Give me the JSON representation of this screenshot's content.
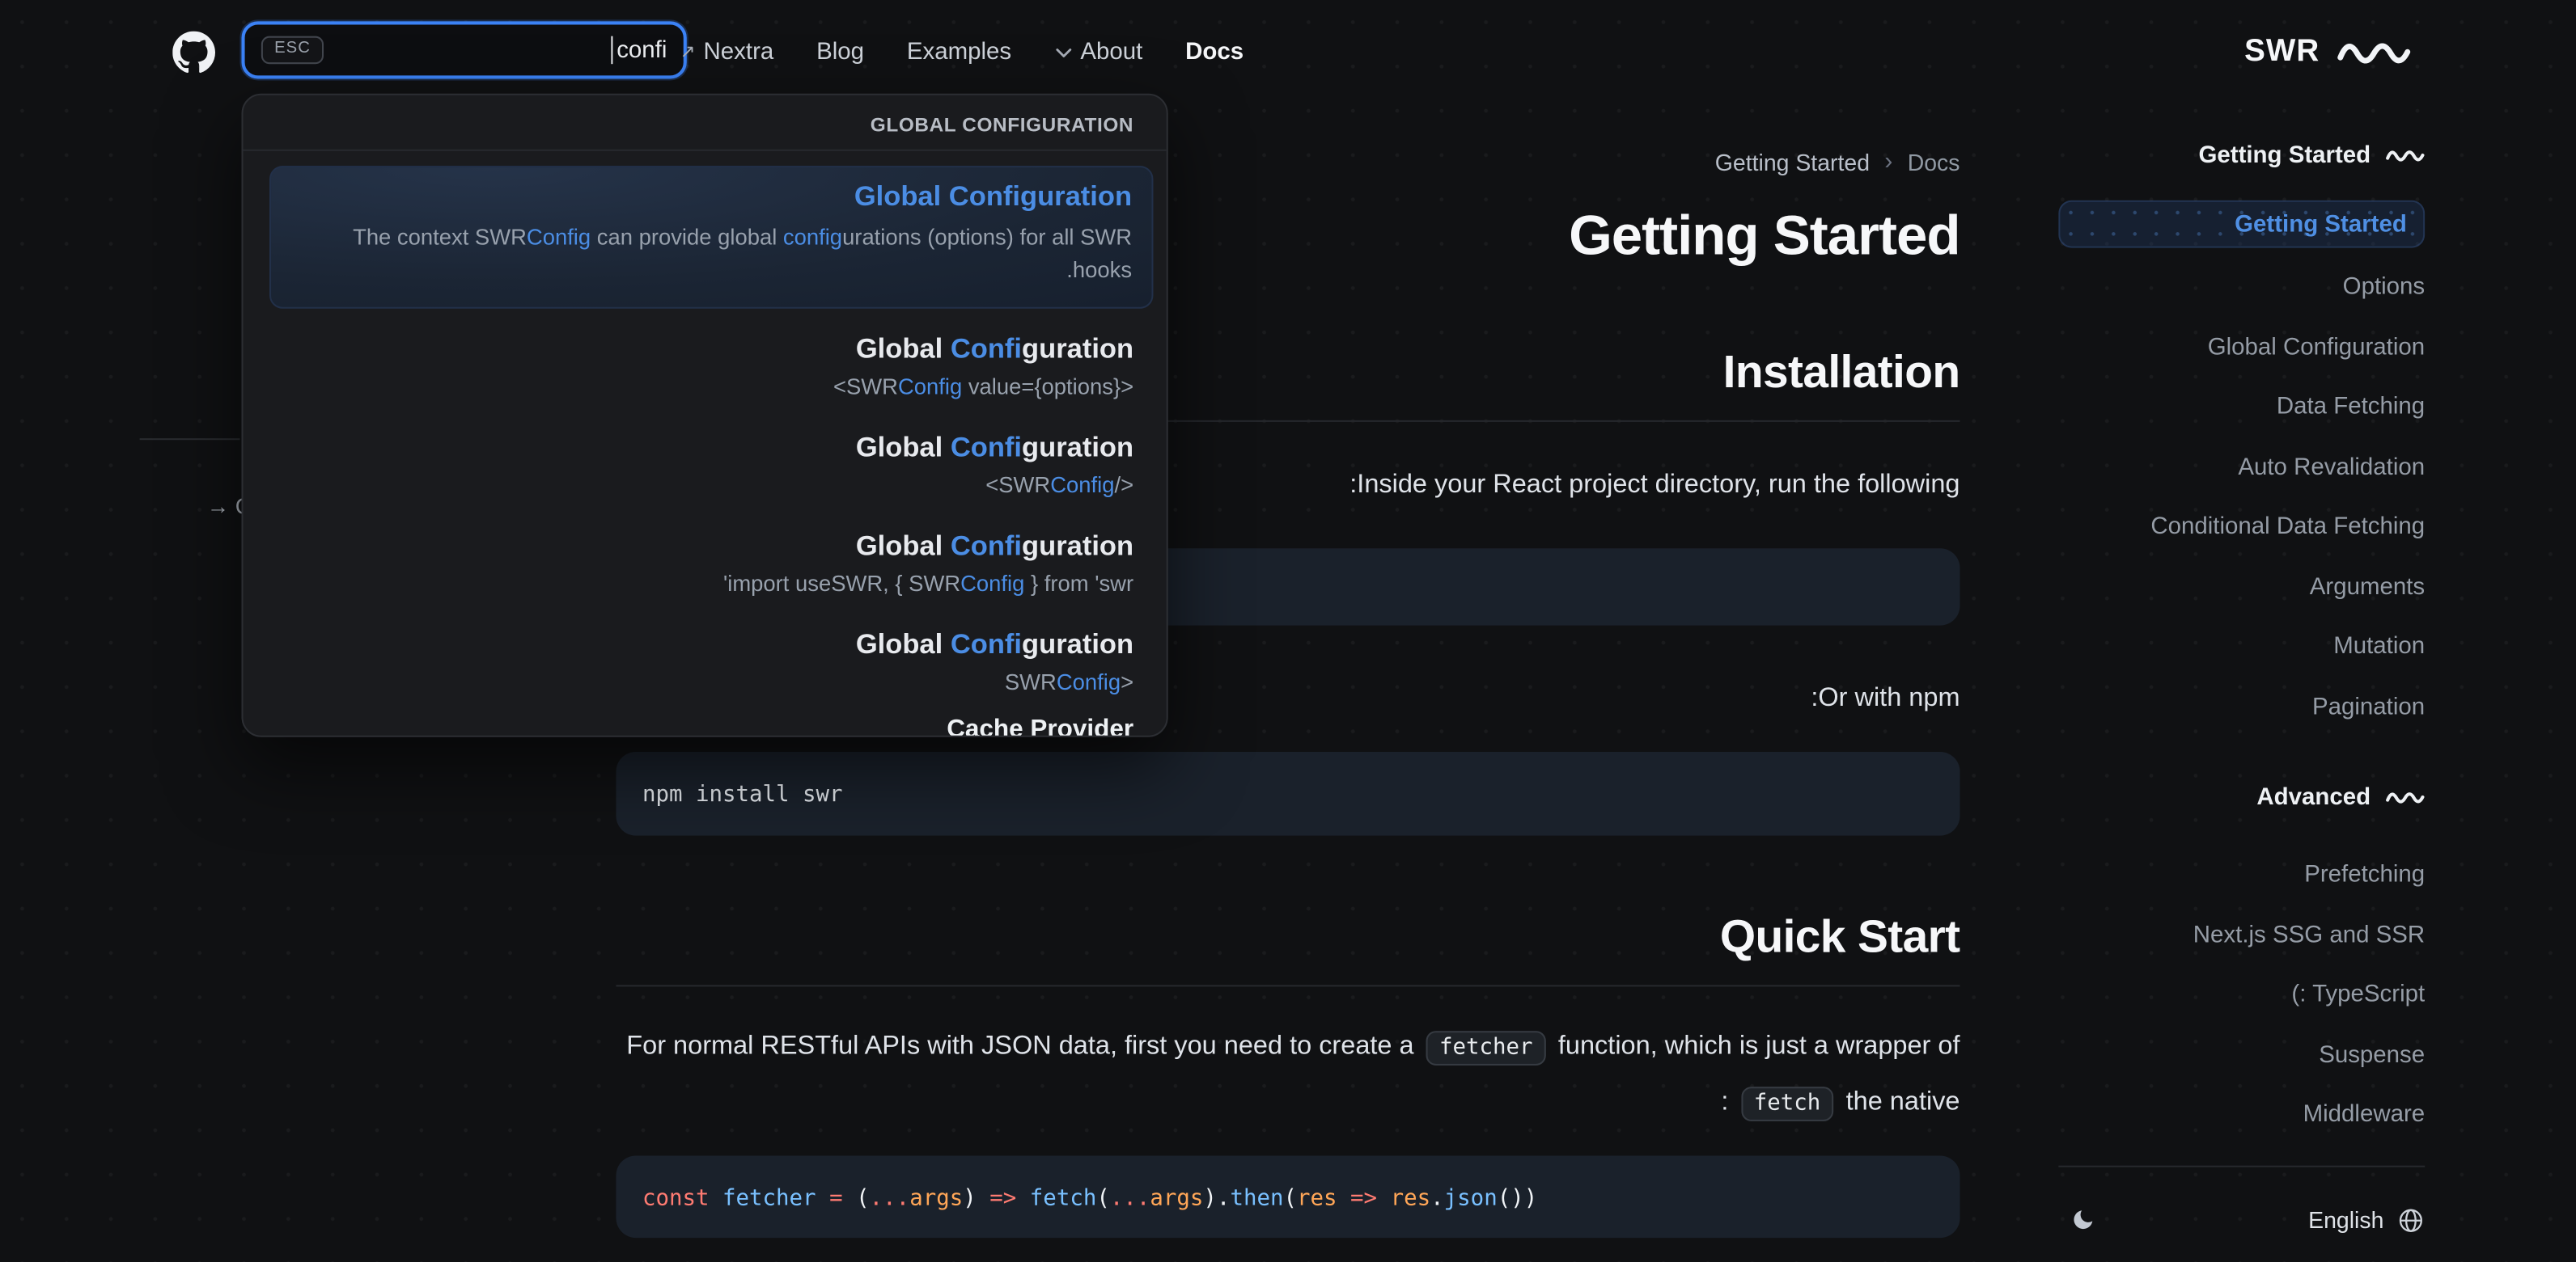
{
  "theme": {
    "accent": "#3b82f6",
    "match_highlight": "#4b8de4",
    "background": "#101113",
    "panel_background": "#1a1b1e",
    "code_background": "#1a212b"
  },
  "navbar": {
    "search": {
      "value": "confi",
      "esc": "ESC"
    },
    "links": {
      "nextra": "Nextra",
      "blog": "Blog",
      "examples": "Examples",
      "about": "About",
      "docs": "Docs"
    },
    "logo": "SWR"
  },
  "toc": {
    "fragment": "→ Q"
  },
  "search_overlay": {
    "section_header": "GLOBAL CONFIGURATION",
    "selected": {
      "title": "Global Configuration",
      "desc1_a": "The context SWR",
      "desc1_b": "Config",
      "desc1_c": " can provide global ",
      "desc1_d": "config",
      "desc1_e": "urations (options) for all SWR",
      "desc2": ".hooks"
    },
    "results": [
      {
        "pre": "Global ",
        "match": "Confi",
        "post": "guration",
        "sub_pre": "<SWR",
        "sub_match": "Config",
        "sub_post": " value={options}>"
      },
      {
        "pre": "Global ",
        "match": "Confi",
        "post": "guration",
        "sub_pre": "<SWR",
        "sub_match": "Config",
        "sub_post": "/>"
      },
      {
        "pre": "Global ",
        "match": "Confi",
        "post": "guration",
        "sub_pre": "'import useSWR, { SWR",
        "sub_match": "Config",
        "sub_post": " } from 'swr"
      },
      {
        "pre": "Global ",
        "match": "Confi",
        "post": "guration",
        "sub_pre": "SWR",
        "sub_match": "Config",
        "sub_post": ">"
      }
    ],
    "next_section": "Cache Provider"
  },
  "main": {
    "breadcrumb": {
      "page": "Getting Started",
      "sep": "›",
      "root": "Docs"
    },
    "title": "Getting Started",
    "installation": {
      "heading": "Installation",
      "intro": ":Inside your React project directory, run the following",
      "or_npm": ":Or with npm",
      "npm_code": "npm install swr"
    },
    "quickstart": {
      "heading": "Quick Start",
      "line1_a": "For normal RESTful APIs with JSON data, first you need to create a ",
      "code1": "fetcher",
      "line1_b": " function, which is just a wrapper of",
      "line2_a": ": ",
      "code2": "fetch",
      "line2_b": " the native",
      "tokens": [
        {
          "t": "const ",
          "c": "k"
        },
        {
          "t": "fetcher",
          "c": "v"
        },
        {
          "t": " ",
          "c": "p"
        },
        {
          "t": "=",
          "c": "k"
        },
        {
          "t": " (",
          "c": "p"
        },
        {
          "t": "...",
          "c": "k"
        },
        {
          "t": "args",
          "c": "a"
        },
        {
          "t": ") ",
          "c": "p"
        },
        {
          "t": "=>",
          "c": "k"
        },
        {
          "t": " ",
          "c": "p"
        },
        {
          "t": "fetch",
          "c": "v"
        },
        {
          "t": "(",
          "c": "p"
        },
        {
          "t": "...",
          "c": "k"
        },
        {
          "t": "args",
          "c": "a"
        },
        {
          "t": ").",
          "c": "p"
        },
        {
          "t": "then",
          "c": "v"
        },
        {
          "t": "(",
          "c": "p"
        },
        {
          "t": "res",
          "c": "a"
        },
        {
          "t": " ",
          "c": "p"
        },
        {
          "t": "=>",
          "c": "k"
        },
        {
          "t": " ",
          "c": "p"
        },
        {
          "t": "res",
          "c": "a"
        },
        {
          "t": ".",
          "c": "p"
        },
        {
          "t": "json",
          "c": "v"
        },
        {
          "t": "())",
          "c": "p"
        }
      ]
    }
  },
  "sidebar": {
    "sections": [
      {
        "title": "Getting Started",
        "items": [
          {
            "label": "Getting Started",
            "active": true
          },
          {
            "label": "Options"
          },
          {
            "label": "Global Configuration"
          },
          {
            "label": "Data Fetching"
          },
          {
            "label": "Auto Revalidation"
          },
          {
            "label": "Conditional Data Fetching"
          },
          {
            "label": "Arguments"
          },
          {
            "label": "Mutation"
          },
          {
            "label": "Pagination"
          }
        ]
      },
      {
        "title": "Advanced",
        "items": [
          {
            "label": "Prefetching"
          },
          {
            "label": "Next.js SSG and SSR"
          },
          {
            "label": "(: TypeScript"
          },
          {
            "label": "Suspense"
          },
          {
            "label": "Middleware"
          }
        ]
      }
    ],
    "footer": {
      "language": "English"
    }
  }
}
